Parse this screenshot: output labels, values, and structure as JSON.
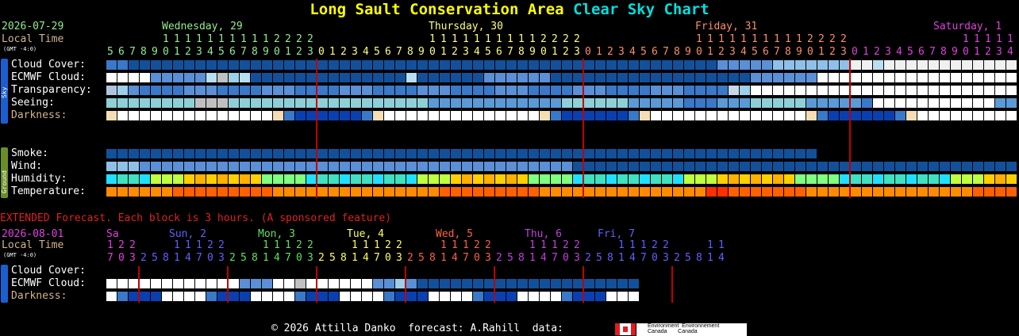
{
  "title": {
    "place": "Long Sault Conservation Area",
    "chart": "Clear Sky Chart",
    "place_color": "#ffff00",
    "chart_color": "#00e0e0"
  },
  "main": {
    "date": "2026-07-29",
    "local_time": "Local Time",
    "gmt": "(GMT -4:0)",
    "days": [
      {
        "label": "Wednesday, 29",
        "color": "#90ee90"
      },
      {
        "label": "Thursday, 30",
        "color": "#ffff80"
      },
      {
        "label": "Friday, 31",
        "color": "#ff8c69"
      },
      {
        "label": "Saturday, 1",
        "color": "#e040e0"
      }
    ],
    "hours": [
      5,
      6,
      7,
      8,
      9,
      10,
      11,
      12,
      13,
      14,
      15,
      16,
      17,
      18,
      19,
      20,
      21,
      22,
      23,
      0,
      1,
      2,
      3,
      4,
      5,
      6,
      7,
      8,
      9,
      10,
      11,
      12,
      13,
      14,
      15,
      16,
      17,
      18,
      19,
      20,
      21,
      22,
      23,
      0,
      1,
      2,
      3,
      4,
      5,
      6,
      7,
      8,
      9,
      10,
      11,
      12,
      13,
      14,
      15,
      16,
      17,
      18,
      19,
      20,
      21,
      22,
      23,
      0,
      1,
      2,
      3,
      4,
      5,
      6,
      7,
      8,
      9,
      10,
      11,
      12,
      13,
      14
    ],
    "sky_side": "Sky",
    "ground_side": "Ground",
    "sky_rows": [
      "Cloud Cover:",
      "ECMWF Cloud:",
      "Transparency:",
      "Seeing:",
      "Darkness:"
    ],
    "ground_rows": [
      "Smoke:",
      "Wind:",
      "Humidity:",
      "Temperature:"
    ]
  },
  "extended": {
    "note": "EXTENDED Forecast. Each block is 3 hours. (A sponsored feature)",
    "date": "2026-08-01",
    "local_time": "Local Time",
    "gmt": "(GMT -4:0)",
    "days": [
      {
        "label": "Sa",
        "color": "#e040e0"
      },
      {
        "label": "Sun, 2",
        "color": "#6060ff"
      },
      {
        "label": "Mon, 3",
        "color": "#60e060"
      },
      {
        "label": "Tue, 4",
        "color": "#ffff60"
      },
      {
        "label": "Wed, 5",
        "color": "#ff6040"
      },
      {
        "label": "Thu, 6",
        "color": "#c040e0"
      },
      {
        "label": "Fri, 7",
        "color": "#6060ff"
      }
    ],
    "hours": [
      17,
      20,
      23,
      2,
      5,
      8,
      11,
      14,
      17,
      20,
      23,
      2,
      5,
      8,
      11,
      14,
      17,
      20,
      23,
      2,
      5,
      8,
      11,
      14,
      17,
      20,
      23,
      2,
      5,
      8,
      11,
      14,
      17,
      20,
      23,
      2,
      5,
      8,
      11,
      14,
      17,
      20,
      23,
      2,
      5,
      8,
      11,
      14,
      17,
      20,
      23,
      2,
      5,
      8,
      11,
      14
    ],
    "rows": [
      "Cloud Cover:",
      "ECMWF Cloud:",
      "Darkness:"
    ]
  },
  "footer": {
    "text": "© 2026 Attilla Danko  forecast: A.Rahill  data:",
    "ec_line1": "Environment  Environnement",
    "ec_line2": "Canada       Canada"
  },
  "colors": {
    "label_text": "#ffffff",
    "darkness_label": "#d2b48c",
    "local_time": "#d2b48c",
    "date": "#90ee90",
    "ext_note": "#e02020"
  }
}
